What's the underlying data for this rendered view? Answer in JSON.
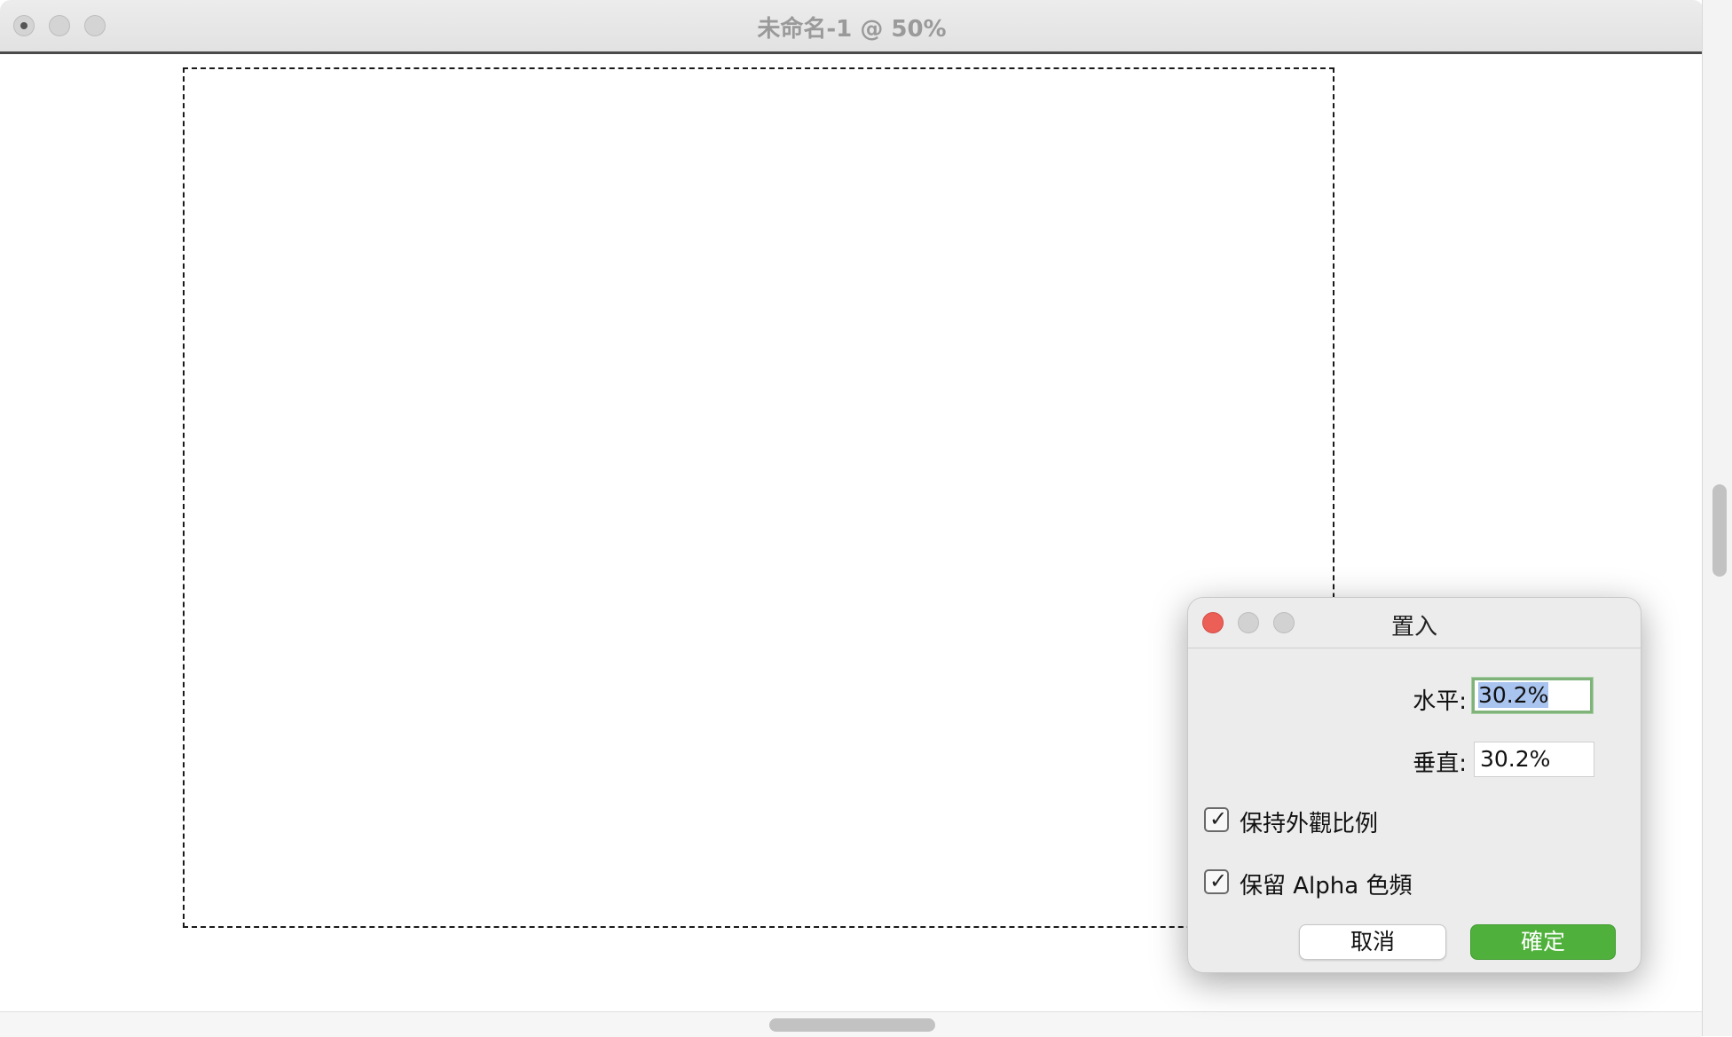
{
  "window": {
    "title": "未命名-1 @ 50%"
  },
  "dialog": {
    "title": "置入",
    "horizontal_label": "水平:",
    "horizontal_value": "30.2%",
    "vertical_label": "垂直:",
    "vertical_value": "30.2%",
    "keep_aspect_label": "保持外觀比例",
    "keep_aspect_checked": true,
    "keep_alpha_label": "保留 Alpha 色頻",
    "keep_alpha_checked": true,
    "cancel_label": "取消",
    "ok_label": "確定",
    "checkmark_glyph": "✓"
  },
  "colors": {
    "ok_button": "#4fb13b",
    "close_button": "#ec5f57",
    "focus_ring": "#7fb37a",
    "selection": "#a9c4ee"
  }
}
